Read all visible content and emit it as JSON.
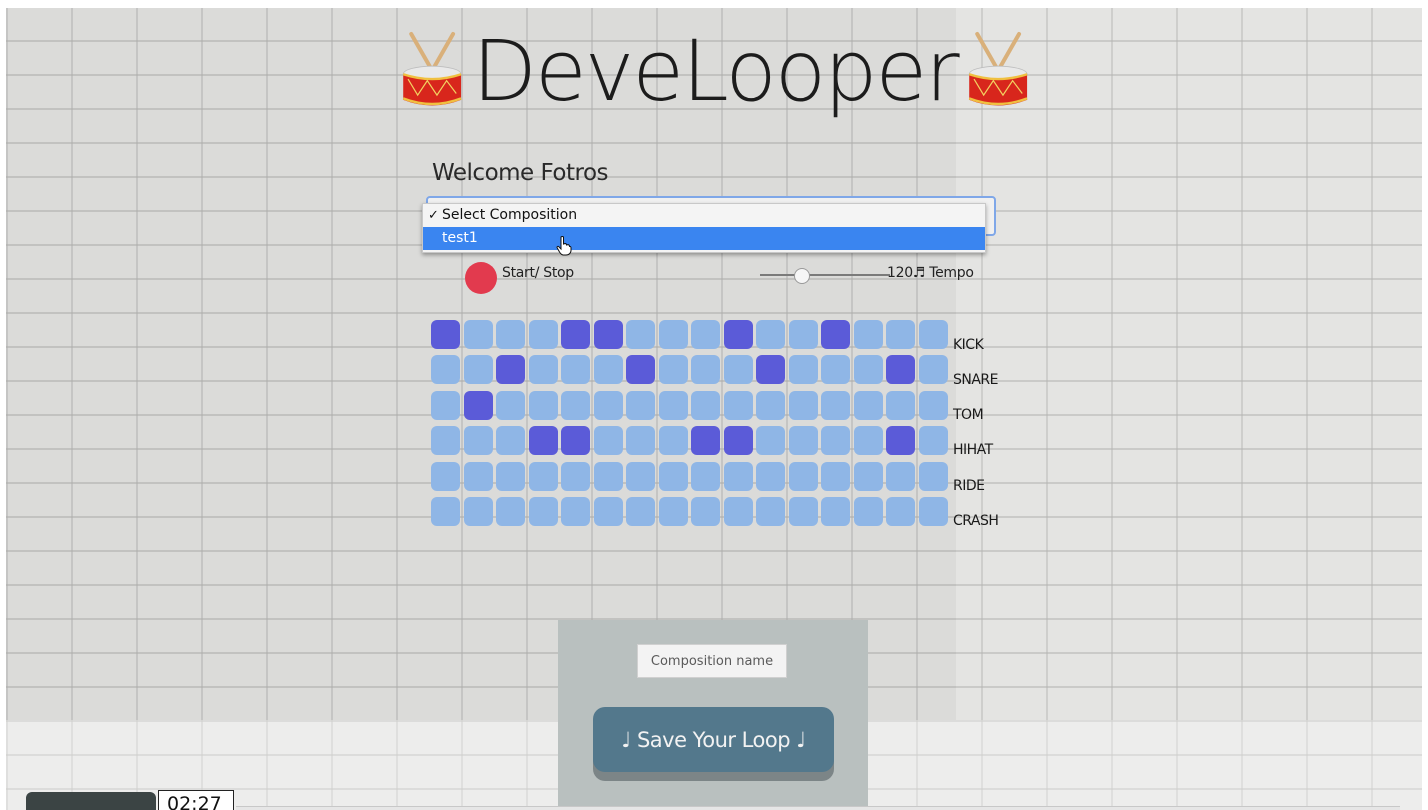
{
  "app": {
    "title": "DeveLooper",
    "welcome": "Welcome Fotros"
  },
  "composition_select": {
    "options": [
      {
        "label": "Select Composition",
        "checked": true
      },
      {
        "label": "test1",
        "highlighted": true
      }
    ]
  },
  "controls": {
    "start_stop_label": "Start/ Stop",
    "tempo_value": "120",
    "tempo_label": "Tempo",
    "tempo_icon": "♬",
    "record_color": "#e23a4e"
  },
  "sequencer": {
    "rows": [
      {
        "label": "KICK",
        "steps": [
          1,
          0,
          0,
          0,
          1,
          1,
          0,
          0,
          0,
          1,
          0,
          0,
          1,
          0,
          0,
          0
        ]
      },
      {
        "label": "SNARE",
        "steps": [
          0,
          0,
          1,
          0,
          0,
          0,
          1,
          0,
          0,
          0,
          1,
          0,
          0,
          0,
          1,
          0
        ]
      },
      {
        "label": "TOM",
        "steps": [
          0,
          1,
          0,
          0,
          0,
          0,
          0,
          0,
          0,
          0,
          0,
          0,
          0,
          0,
          0,
          0
        ]
      },
      {
        "label": "HIHAT",
        "steps": [
          0,
          0,
          0,
          1,
          1,
          0,
          0,
          0,
          1,
          1,
          0,
          0,
          0,
          0,
          1,
          0
        ]
      },
      {
        "label": "RIDE",
        "steps": [
          0,
          0,
          0,
          0,
          0,
          0,
          0,
          0,
          0,
          0,
          0,
          0,
          0,
          0,
          0,
          0
        ]
      },
      {
        "label": "CRASH",
        "steps": [
          0,
          0,
          0,
          0,
          0,
          0,
          0,
          0,
          0,
          0,
          0,
          0,
          0,
          0,
          0,
          0
        ]
      }
    ],
    "active_color": "#5b5bd8",
    "inactive_color": "#8fb6e6"
  },
  "save": {
    "input_placeholder": "Composition name",
    "button_label": "♩ Save Your Loop ♩"
  },
  "video": {
    "time": "02:27"
  }
}
